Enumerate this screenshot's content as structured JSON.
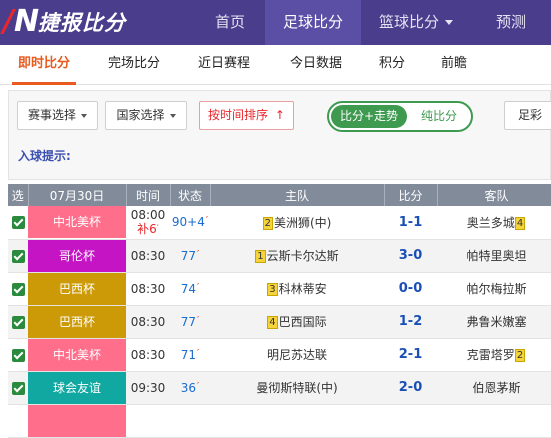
{
  "brand": {
    "name": "捷报比分"
  },
  "nav": [
    {
      "label": "首页",
      "active": false
    },
    {
      "label": "足球比分",
      "active": true
    },
    {
      "label": "篮球比分",
      "active": false
    },
    {
      "label": "预测",
      "active": false
    }
  ],
  "subnav": [
    {
      "label": "即时比分",
      "active": true
    },
    {
      "label": "完场比分",
      "active": false
    },
    {
      "label": "近日赛程",
      "active": false
    },
    {
      "label": "今日数据",
      "active": false
    },
    {
      "label": "积分",
      "active": false
    },
    {
      "label": "前瞻",
      "active": false
    }
  ],
  "toolbar": {
    "event_select": "赛事选择",
    "country_select": "国家选择",
    "sort_by_time": "按时间排序",
    "mode_on": "比分+走势",
    "mode_off": "纯比分",
    "lottery": "足彩",
    "goal_hint": "入球提示:"
  },
  "table": {
    "headers": {
      "select": "选",
      "date": "07月30日",
      "time": "时间",
      "status": "状态",
      "home": "主队",
      "score": "比分",
      "away": "客队"
    },
    "rows": [
      {
        "league": "中北美杯",
        "league_color": "#ff6f8c",
        "time": "08:00",
        "extra": "补6",
        "status": "90+4",
        "home_rank": "2",
        "home": "美洲狮(中)",
        "score": "1-1",
        "away": "奥兰多城",
        "away_rank": "4"
      },
      {
        "league": "哥伦杯",
        "league_color": "#c414c4",
        "time": "08:30",
        "extra": "",
        "status": "77",
        "home_rank": "1",
        "home": "云斯卡尔达斯",
        "score": "3-0",
        "away": "帕特里奥坦",
        "away_rank": ""
      },
      {
        "league": "巴西杯",
        "league_color": "#cc9a06",
        "time": "08:30",
        "extra": "",
        "status": "74",
        "home_rank": "3",
        "home": "科林蒂安",
        "score": "0-0",
        "away": "帕尔梅拉斯",
        "away_rank": ""
      },
      {
        "league": "巴西杯",
        "league_color": "#cc9a06",
        "time": "08:30",
        "extra": "",
        "status": "77",
        "home_rank": "4",
        "home": "巴西国际",
        "score": "1-2",
        "away": "弗鲁米嫩塞",
        "away_rank": ""
      },
      {
        "league": "中北美杯",
        "league_color": "#ff6f8c",
        "time": "08:30",
        "extra": "",
        "status": "71",
        "home_rank": "",
        "home": "明尼苏达联",
        "score": "2-1",
        "away": "克雷塔罗",
        "away_rank": "2"
      },
      {
        "league": "球会友谊",
        "league_color": "#10a8a0",
        "time": "09:30",
        "extra": "",
        "status": "36",
        "home_rank": "",
        "home": "曼彻斯特联(中)",
        "score": "2-0",
        "away": "伯恩茅斯",
        "away_rank": ""
      },
      {
        "league": "",
        "league_color": "#ff6f8c",
        "time": "",
        "extra": "",
        "status": "",
        "home_rank": "",
        "home": "",
        "score": "",
        "away": "",
        "away_rank": ""
      }
    ]
  }
}
